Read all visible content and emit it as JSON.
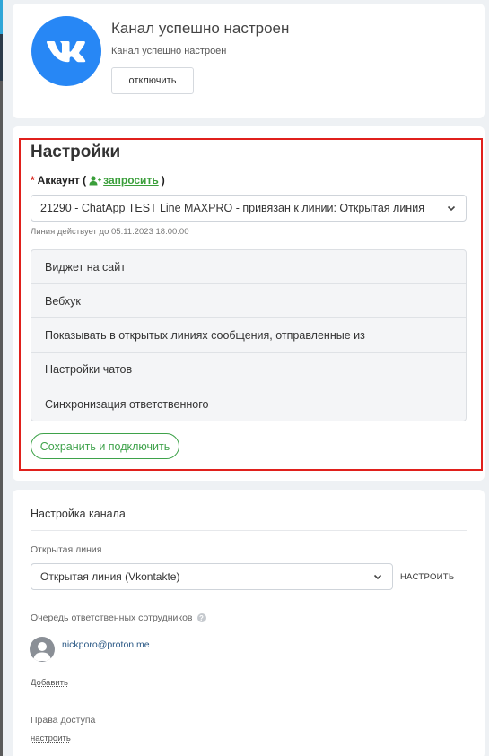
{
  "header": {
    "title": "Канал успешно настроен",
    "subtitle": "Канал успешно настроен",
    "disconnect_label": "отключить",
    "logo_color": "#2787f5"
  },
  "settings": {
    "title": "Настройки",
    "account_label": "Аккаунт (",
    "account_label_end": ")",
    "required_mark": "*",
    "request_link": "запросить",
    "account_select_value": "21290 - ChatApp TEST Line MAXPRO - привязан к линии: Открытая линия",
    "line_until": "Линия действует до 05.11.2023 18:00:00",
    "accordion": [
      "Виджет на сайт",
      "Вебхук",
      "Показывать в открытых линиях сообщения, отправленные из",
      "Настройки чатов",
      "Синхронизация ответственного"
    ],
    "save_label": "Сохранить и подключить",
    "highlight_color": "#e0201c",
    "accent_color": "#3ea24a"
  },
  "channel": {
    "title": "Настройка канала",
    "open_line_label": "Открытая линия",
    "open_line_value": "Открытая линия (Vkontakte)",
    "configure_label": "настроить",
    "queue_label": "Очередь ответственных сотрудников",
    "user_email": "nickporo@proton.me",
    "add_label": "Добавить",
    "access_label": "Права доступа",
    "access_link": "настроить"
  }
}
